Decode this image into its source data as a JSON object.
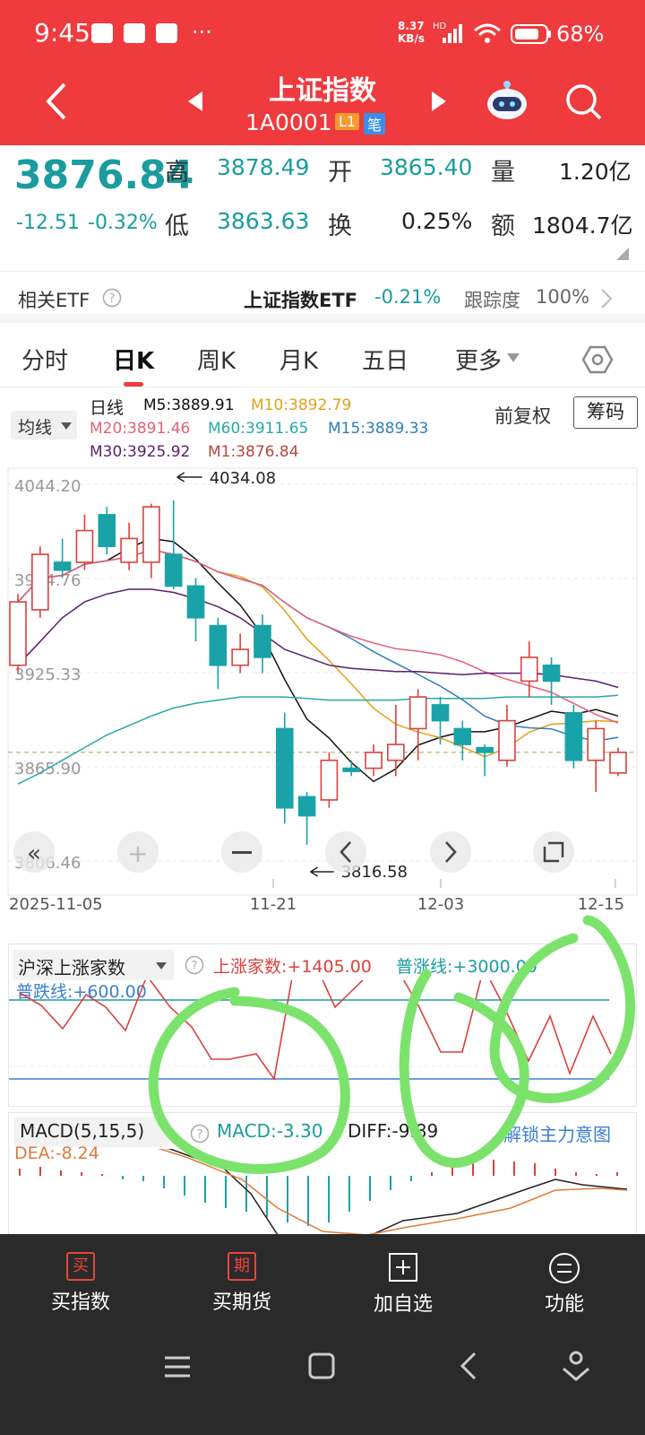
{
  "status": {
    "time": "9:45",
    "dots": "···",
    "speed_top": "8.37",
    "speed_bottom": "KB/s",
    "network": "HD",
    "battery": "68%"
  },
  "nav": {
    "title": "上证指数",
    "code": "1A0001",
    "badge_l1": "L1",
    "badge_bi": "笔"
  },
  "quote": {
    "price": "3876.84",
    "change": "-12.51",
    "change_pct": "-0.32%",
    "high_label": "高",
    "high": "3878.49",
    "open_label": "开",
    "open": "3865.40",
    "vol_label": "量",
    "vol": "1.20亿",
    "low_label": "低",
    "low": "3863.63",
    "turn_label": "换",
    "turn": "0.25%",
    "amt_label": "额",
    "amt": "1804.7亿"
  },
  "etf": {
    "label": "相关ETF",
    "name": "上证指数ETF",
    "change": "-0.21%",
    "track_label": "跟踪度",
    "track": "100%"
  },
  "tabs": [
    "分时",
    "日K",
    "周K",
    "月K",
    "五日",
    "更多"
  ],
  "legend": {
    "ma_button": "均线",
    "line_type": "日线",
    "m5": "M5:3889.91",
    "m10": "M10:3892.79",
    "m20": "M20:3891.46",
    "m60": "M60:3911.65",
    "m15": "M15:3889.33",
    "m30": "M30:3925.92",
    "m1": "M1:3876.84",
    "fq": "前复权",
    "chip": "筹码"
  },
  "chart_data": [
    {
      "type": "candlestick",
      "title": "日K",
      "y_ticks": [
        "4044.20",
        "3984.76",
        "3925.33",
        "3865.90",
        "3806.46"
      ],
      "x_ticks": [
        "2025-11-05",
        "11-21",
        "12-03",
        "12-15"
      ],
      "annotations": [
        "4034.08",
        "3816.58"
      ],
      "candles": [
        {
          "o": 3930,
          "c": 3970,
          "h": 3975,
          "l": 3925
        },
        {
          "o": 3965,
          "c": 4000,
          "h": 4005,
          "l": 3960
        },
        {
          "o": 3995,
          "c": 3990,
          "h": 4010,
          "l": 3985
        },
        {
          "o": 3995,
          "c": 4015,
          "h": 4025,
          "l": 3990
        },
        {
          "o": 4025,
          "c": 4005,
          "h": 4030,
          "l": 4000
        },
        {
          "o": 3995,
          "c": 4010,
          "h": 4020,
          "l": 3990
        },
        {
          "o": 3995,
          "c": 4030,
          "h": 4032,
          "l": 3985
        },
        {
          "o": 4000,
          "c": 3980,
          "h": 4034.08,
          "l": 3978
        },
        {
          "o": 3980,
          "c": 3960,
          "h": 3985,
          "l": 3945
        },
        {
          "o": 3955,
          "c": 3930,
          "h": 3960,
          "l": 3915
        },
        {
          "o": 3930,
          "c": 3940,
          "h": 3950,
          "l": 3925
        },
        {
          "o": 3955,
          "c": 3935,
          "h": 3962,
          "l": 3925
        },
        {
          "o": 3890,
          "c": 3840,
          "h": 3900,
          "l": 3830
        },
        {
          "o": 3847,
          "c": 3835,
          "h": 3850,
          "l": 3816.58
        },
        {
          "o": 3845,
          "c": 3870,
          "h": 3875,
          "l": 3840
        },
        {
          "o": 3865,
          "c": 3863,
          "h": 3870,
          "l": 3860
        },
        {
          "o": 3865,
          "c": 3875,
          "h": 3880,
          "l": 3860
        },
        {
          "o": 3870,
          "c": 3880,
          "h": 3905,
          "l": 3860
        },
        {
          "o": 3890,
          "c": 3910,
          "h": 3915,
          "l": 3870
        },
        {
          "o": 3905,
          "c": 3895,
          "h": 3910,
          "l": 3880
        },
        {
          "o": 3890,
          "c": 3880,
          "h": 3895,
          "l": 3870
        },
        {
          "o": 3878,
          "c": 3875,
          "h": 3880,
          "l": 3860
        },
        {
          "o": 3870,
          "c": 3895,
          "h": 3905,
          "l": 3866
        },
        {
          "o": 3920,
          "c": 3935,
          "h": 3945,
          "l": 3910
        },
        {
          "o": 3930,
          "c": 3920,
          "h": 3935,
          "l": 3905
        },
        {
          "o": 3900,
          "c": 3870,
          "h": 3905,
          "l": 3865
        },
        {
          "o": 3870,
          "c": 3890,
          "h": 3895,
          "l": 3850
        },
        {
          "o": 3862,
          "c": 3875,
          "h": 3878,
          "l": 3860
        }
      ]
    },
    {
      "type": "line",
      "title": "沪深上涨家数",
      "series": [
        {
          "name": "上涨家数",
          "value": "+1405.00"
        },
        {
          "name": "普涨线",
          "value": "+3000.00"
        },
        {
          "name": "普跌线",
          "value": "+600.00"
        }
      ]
    },
    {
      "type": "bar",
      "title": "MACD(5,15,5)",
      "series": [
        {
          "name": "MACD",
          "value": "-3.30"
        },
        {
          "name": "DIFF",
          "value": "-9.89"
        },
        {
          "name": "DEA",
          "value": "-8.24"
        }
      ]
    }
  ],
  "indicators": {
    "breadth_title": "沪深上涨家数",
    "breadth_up": "上涨家数:+1405.00",
    "breadth_rise": "普涨线:+3000.00",
    "breadth_fall": "普跌线:+600.00",
    "macd_title": "MACD(5,15,5)",
    "macd": "MACD:-3.30",
    "diff": "DIFF:-9.89",
    "dea": "DEA:-8.24",
    "lock": "解锁主力意图"
  },
  "bottom": {
    "buy_index": "买指数",
    "buy_futures": "买期货",
    "add_watch": "加自选",
    "function": "功能",
    "buy_icon": "买",
    "futures_icon": "期"
  },
  "colors": {
    "header": "#ef3a3e",
    "teal": "#1a9c9e",
    "red_candle": "#d9413e",
    "green_ann": "#7be36b"
  }
}
